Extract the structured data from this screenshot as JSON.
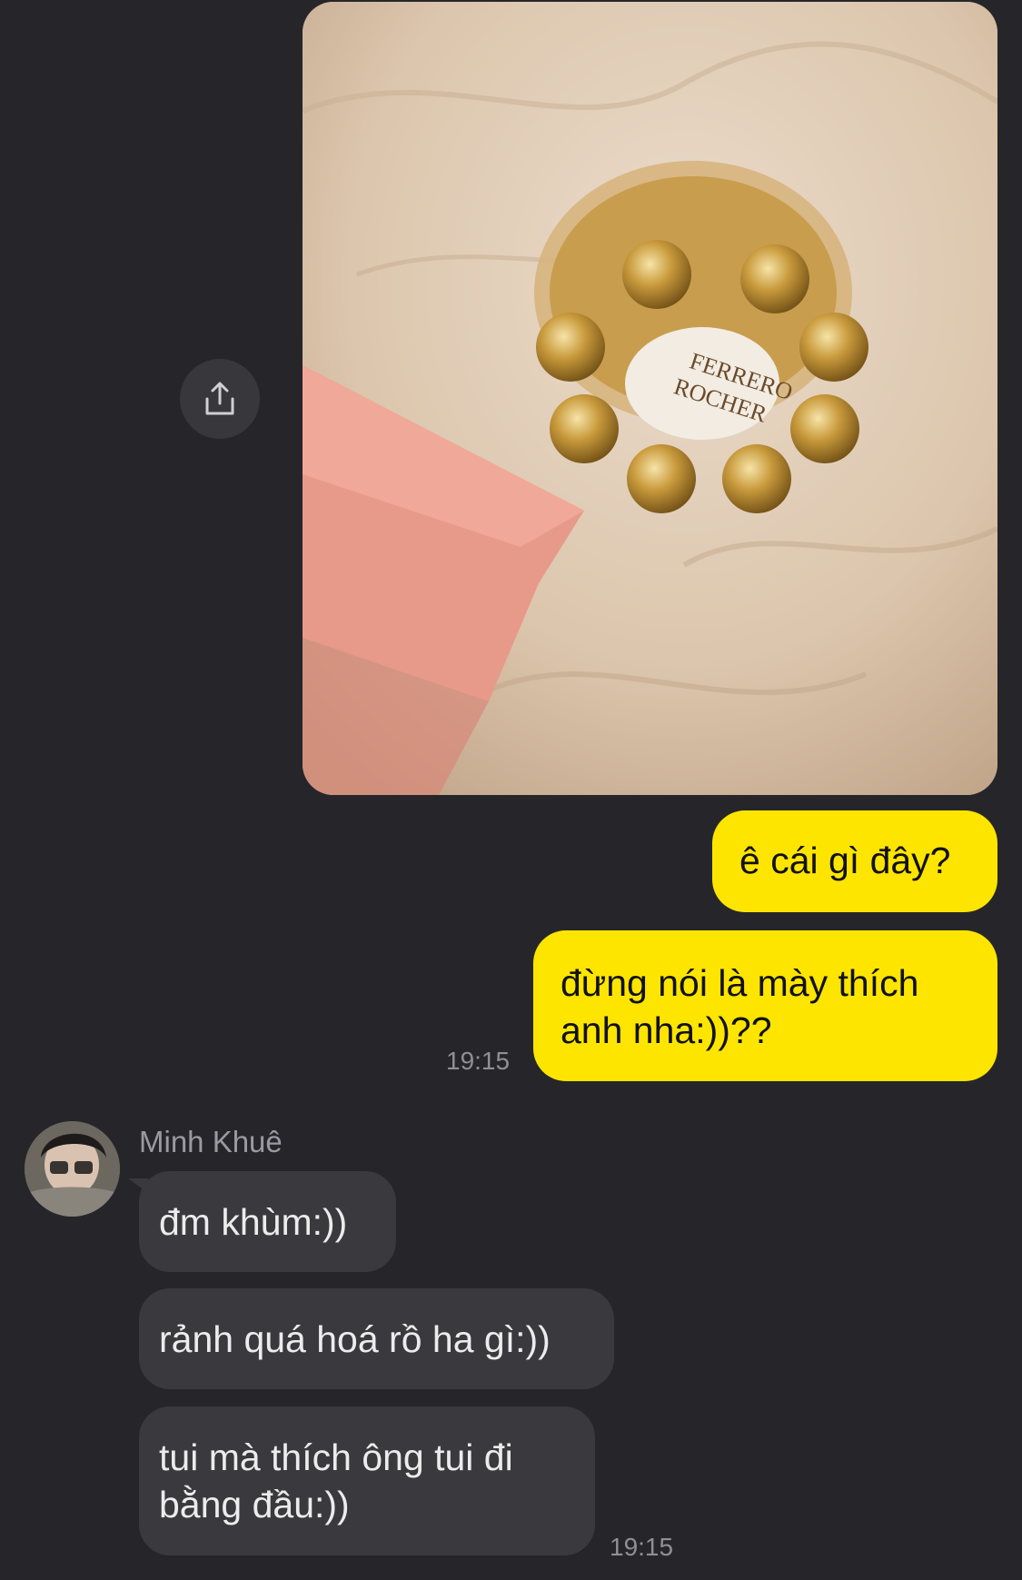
{
  "chat": {
    "shared_photo": {
      "logo_text_line1": "FERRERO",
      "logo_text_line2": "ROCHER"
    },
    "share_icon": "share-icon",
    "messages_out": [
      {
        "text": "ê cái gì đây?"
      },
      {
        "text": "đừng nói là mày thích anh nha:))??"
      }
    ],
    "time_out": "19:15",
    "contact": {
      "name": "Minh Khuê",
      "avatar_icon": "avatar"
    },
    "messages_in": [
      {
        "text": "đm khùm:))"
      },
      {
        "text": "rảnh quá hoá rồ ha gì:))"
      },
      {
        "text": "tui mà thích ông tui đi bằng đầu:))"
      }
    ],
    "time_in": "19:15"
  },
  "colors": {
    "background": "#26262a",
    "outgoing_bubble": "#fee500",
    "incoming_bubble": "#3a3a3e",
    "timestamp": "#8f8f94"
  }
}
